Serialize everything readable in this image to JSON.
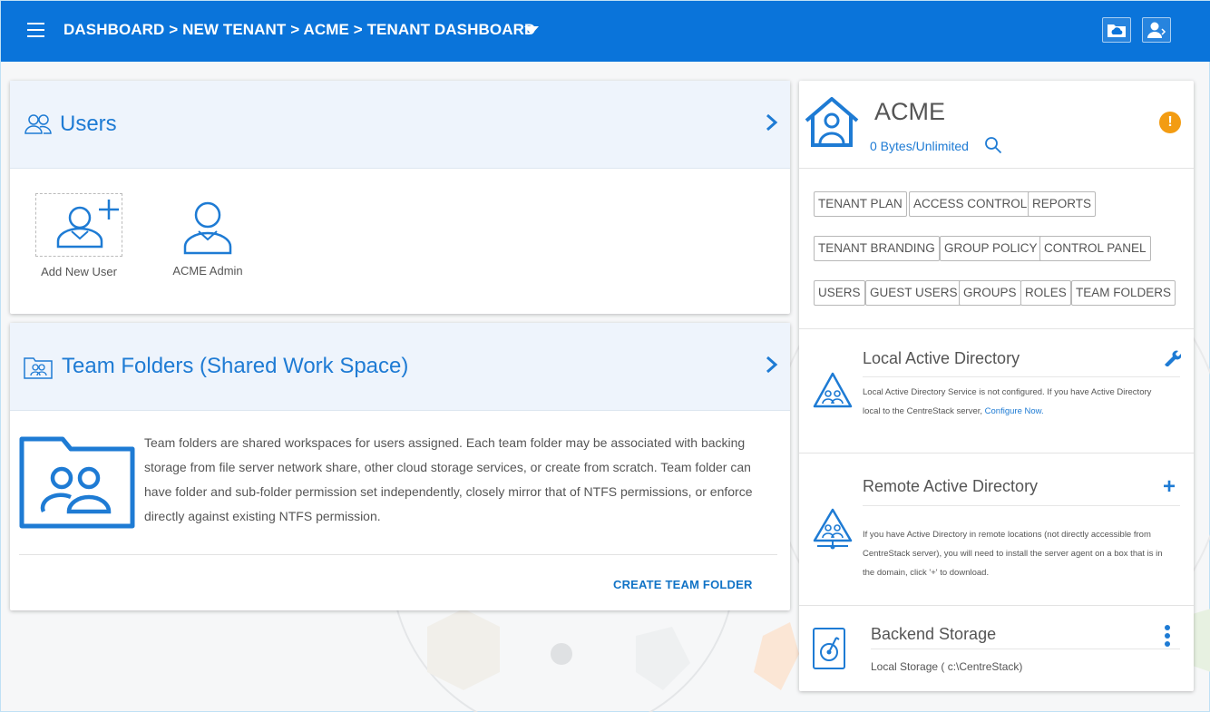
{
  "header": {
    "breadcrumb": "DASHBOARD > NEW TENANT > ACME > TENANT DASHBOARD",
    "icons": [
      "menu-icon",
      "cloud-folder-icon",
      "user-logout-icon"
    ],
    "bg_color": "#0a74da"
  },
  "users_card": {
    "title": "Users",
    "users": [
      {
        "label": "Add New User",
        "icon": "add-user-icon"
      },
      {
        "label": "ACME Admin",
        "icon": "user-icon"
      }
    ]
  },
  "team_folders_card": {
    "title": "Team Folders (Shared Work Space)",
    "description": "Team folders are shared workspaces for users assigned. Each team folder may be associated with backing storage from file server network share, other cloud storage services, or create from scratch. Team folder can have folder and sub-folder permission set independently, closely mirror that of NTFS permissions, or enforce directly against existing NTFS permission.",
    "action": "CREATE TEAM FOLDER"
  },
  "tenant": {
    "name": "ACME",
    "usage": "0 Bytes/Unlimited",
    "buttons_row1": [
      "TENANT PLAN",
      "ACCESS CONTROL",
      "REPORTS"
    ],
    "buttons_row2": [
      "TENANT BRANDING",
      "GROUP POLICY",
      "CONTROL PANEL"
    ],
    "buttons_row3": [
      "USERS",
      "GUEST USERS",
      "GROUPS",
      "ROLES",
      "TEAM FOLDERS"
    ],
    "local_ad": {
      "title": "Local Active Directory",
      "text": "Local Active Directory Service is not configured. If you have Active Directory local to the CentreStack server, ",
      "link": "Configure Now."
    },
    "remote_ad": {
      "title": "Remote Active Directory",
      "text": "If you have Active Directory in remote locations (not directly accessible from CentreStack server), you will need to install the server agent on a box that is in the domain, click '+' to download."
    },
    "storage": {
      "title": "Backend Storage",
      "value": "Local Storage ( c:\\CentreStack)"
    }
  },
  "colors": {
    "accent": "#1e7bd4",
    "warning": "#f39c12"
  }
}
